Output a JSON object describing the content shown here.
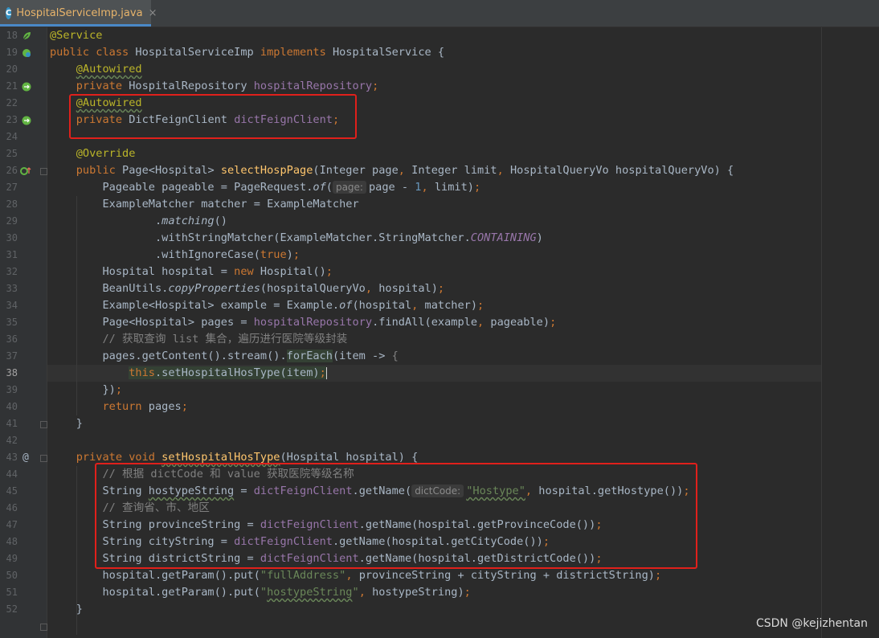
{
  "tab": {
    "label": "HospitalServiceImp.java",
    "icon": "C",
    "close": "×"
  },
  "gutter": {
    "line_numbers": [
      "18",
      "19",
      "20",
      "21",
      "22",
      "23",
      "24",
      "25",
      "26",
      "27",
      "28",
      "29",
      "30",
      "31",
      "32",
      "33",
      "34",
      "35",
      "36",
      "37",
      "38",
      "39",
      "40",
      "41",
      "42",
      "43",
      "44",
      "45",
      "46",
      "47",
      "48",
      "49",
      "50",
      "51",
      "52"
    ],
    "current_line": "38"
  },
  "code": {
    "l18": {
      "a": "@Service"
    },
    "l19": {
      "a": "public class ",
      "b": "HospitalServiceImp ",
      "c": "implements ",
      "d": "HospitalService {"
    },
    "l20": {
      "a": "@Autowired"
    },
    "l21": {
      "a": "private ",
      "b": "HospitalRepository ",
      "c": "hospitalRepository",
      "d": ";"
    },
    "l22": {
      "a": "@Autowired"
    },
    "l23": {
      "a": "private ",
      "b": "DictFeignClient ",
      "c": "dictFeignClient",
      "d": ";"
    },
    "l25": {
      "a": "@Override"
    },
    "l26": {
      "a": "public ",
      "b": "Page<Hospital> ",
      "c": "selectHospPage",
      "d": "(Integer page",
      "e": ", ",
      "f": "Integer limit",
      "g": ", ",
      "h": "HospitalQueryVo hospitalQueryVo) {"
    },
    "l27": {
      "a": "Pageable pageable = PageRequest.",
      "b": "of",
      "c": "(",
      "hint": "page:",
      "d": "page - ",
      "e": "1",
      "f": ", ",
      "g": "limit)",
      "h": ";"
    },
    "l28": {
      "a": "ExampleMatcher matcher = ExampleMatcher"
    },
    "l29": {
      "a": ".",
      "b": "matching",
      "c": "()"
    },
    "l30": {
      "a": ".withStringMatcher(ExampleMatcher.StringMatcher.",
      "b": "CONTAINING",
      "c": ")"
    },
    "l31": {
      "a": ".withIgnoreCase(",
      "b": "true",
      "c": ")",
      "d": ";"
    },
    "l32": {
      "a": "Hospital hospital = ",
      "b": "new ",
      "c": "Hospital()",
      "d": ";"
    },
    "l33": {
      "a": "BeanUtils.",
      "b": "copyProperties",
      "c": "(hospitalQueryVo",
      "d": ", ",
      "e": "hospital)",
      "f": ";"
    },
    "l34": {
      "a": "Example<Hospital> example = Example.",
      "b": "of",
      "c": "(hospital",
      "d": ", ",
      "e": "matcher)",
      "f": ";"
    },
    "l35": {
      "a": "Page<Hospital> pages = ",
      "b": "hospitalRepository",
      "c": ".findAll(example",
      "d": ", ",
      "e": "pageable)",
      "f": ";"
    },
    "l36": {
      "a": "// 获取查询 list 集合，遍历进行医院等级封装"
    },
    "l37": {
      "a": "pages.getContent().stream().",
      "b": "forEach",
      "c": "(item -> ",
      "d": "{"
    },
    "l38": {
      "a": "this",
      "b": ".setHospitalHosType(item)",
      "c": ";"
    },
    "l39": {
      "a": "})",
      "b": ";"
    },
    "l40": {
      "a": "return ",
      "b": "pages",
      "c": ";"
    },
    "l41": {
      "a": "}"
    },
    "l43": {
      "a": "private ",
      "b": "void ",
      "c": "setHospitalHosType",
      "d": "(Hospital hospital) {"
    },
    "l44": {
      "a": "// 根据 dictCode 和 value 获取医院等级名称"
    },
    "l45": {
      "a": "String ",
      "b": "hostypeString",
      "c": " = ",
      "d": "dictFeignClient",
      "e": ".getName(",
      "hint": "dictCode:",
      "f": "\"Hostype\"",
      "g": ", ",
      "h": "hospital.getHostype())",
      "i": ";"
    },
    "l46": {
      "a": "// 查询省、市、地区"
    },
    "l47": {
      "a": "String provinceString = ",
      "b": "dictFeignClient",
      "c": ".getName(hospital.getProvinceCode())",
      "d": ";"
    },
    "l48": {
      "a": "String cityString = ",
      "b": "dictFeignClient",
      "c": ".getName(hospital.getCityCode())",
      "d": ";"
    },
    "l49": {
      "a": "String districtString = ",
      "b": "dictFeignClient",
      "c": ".getName(hospital.getDistrictCode())",
      "d": ";"
    },
    "l50": {
      "a": "hospital.getParam().put(",
      "b": "\"fullAddress\"",
      "c": ", ",
      "d": "provinceString + cityString + districtString)",
      "e": ";"
    },
    "l51": {
      "a": "hospital.getParam().put(",
      "b": "\"",
      "c": "hostypeString",
      "d": "\"",
      "e": ", ",
      "f": "hostypeString)",
      "g": ";"
    },
    "l52": {
      "a": "}"
    }
  },
  "gutter_icons": {
    "l18": "bean-icon",
    "l19": "bean-icon",
    "l21": "autowired-icon",
    "l23": "autowired-icon",
    "l26": "implements-method-icon",
    "l38": "lightbulb-icon",
    "l43": "at-annotation-icon",
    "l43_label": "@"
  },
  "colors": {
    "highlight_box": "#e0201b",
    "background": "#2b2b2b",
    "keyword": "#cc7832",
    "annotation": "#bbb529",
    "field": "#9876aa",
    "method": "#ffc66d",
    "string": "#6a8759"
  },
  "watermark": "CSDN @kejizhentan"
}
